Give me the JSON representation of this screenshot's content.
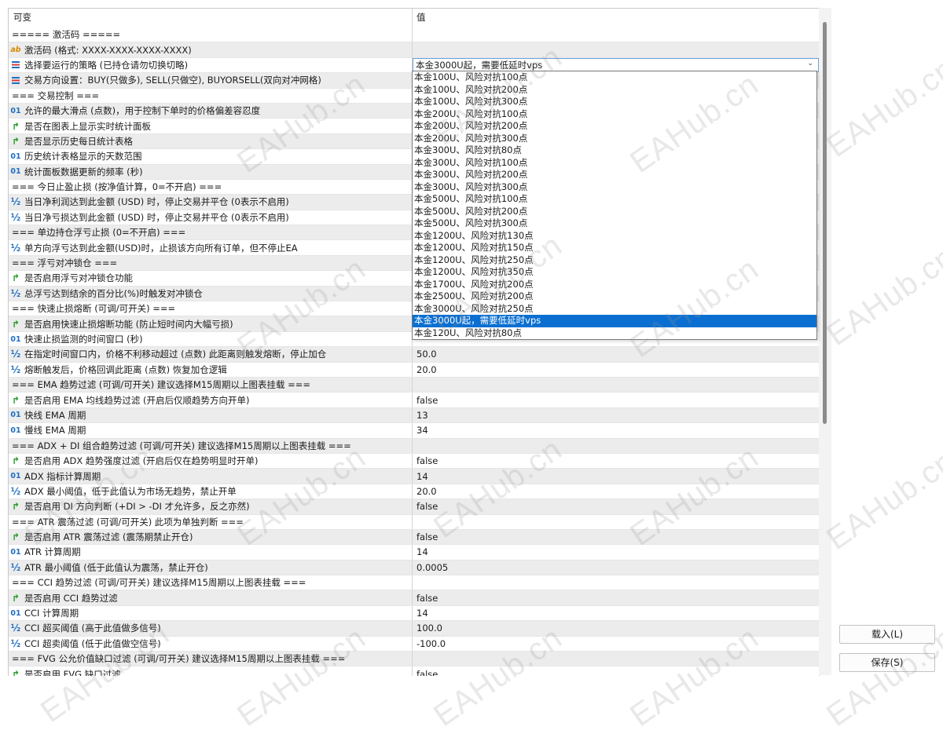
{
  "header": {
    "col_name": "可变",
    "col_value": "值"
  },
  "rows": [
    {
      "t": "none",
      "label": "===== 激活码 =====",
      "value": ""
    },
    {
      "t": "str",
      "label": "激活码 (格式: XXXX-XXXX-XXXX-XXXX)",
      "value": ""
    },
    {
      "t": "enum",
      "label": "选择要运行的策略 (已持仓请勿切换切略)",
      "value": "本金3000U起，需要低延时vps",
      "selected": true
    },
    {
      "t": "enum",
      "label": "交易方向设置：BUY(只做多), SELL(只做空), BUYORSELL(双向对冲网格)",
      "value": ""
    },
    {
      "t": "none",
      "label": "=== 交易控制 ===",
      "value": ""
    },
    {
      "t": "int",
      "label": "允许的最大滑点 (点数)，用于控制下单时的价格偏差容忍度",
      "value": ""
    },
    {
      "t": "bool",
      "label": "是否在图表上显示实时统计面板",
      "value": ""
    },
    {
      "t": "bool",
      "label": "是否显示历史每日统计表格",
      "value": ""
    },
    {
      "t": "int",
      "label": "历史统计表格显示的天数范围",
      "value": ""
    },
    {
      "t": "int",
      "label": "统计面板数据更新的频率 (秒)",
      "value": ""
    },
    {
      "t": "none",
      "label": "=== 今日止盈止损 (按净值计算，0=不开启) ===",
      "value": ""
    },
    {
      "t": "dbl",
      "label": "当日净利润达到此金额 (USD) 时，停止交易并平仓 (0表示不启用)",
      "value": ""
    },
    {
      "t": "dbl",
      "label": "当日净亏损达到此金额 (USD) 时，停止交易并平仓 (0表示不启用)",
      "value": ""
    },
    {
      "t": "none",
      "label": "=== 单边持仓浮亏止损 (0=不开启) ===",
      "value": ""
    },
    {
      "t": "dbl",
      "label": "单方向浮亏达到此金额(USD)时，止损该方向所有订单，但不停止EA",
      "value": ""
    },
    {
      "t": "none",
      "label": "=== 浮亏对冲锁仓 ===",
      "value": ""
    },
    {
      "t": "bool",
      "label": "是否启用浮亏对冲锁仓功能",
      "value": ""
    },
    {
      "t": "dbl",
      "label": "总浮亏达到结余的百分比(%)时触发对冲锁仓",
      "value": ""
    },
    {
      "t": "none",
      "label": "=== 快速止损熔断 (可调/可开关) ===",
      "value": ""
    },
    {
      "t": "bool",
      "label": "是否启用快速止损熔断功能 (防止短时间内大幅亏损)",
      "value": ""
    },
    {
      "t": "int",
      "label": "快速止损监测的时间窗口 (秒)",
      "value": ""
    },
    {
      "t": "dbl",
      "label": "在指定时间窗口内，价格不利移动超过 (点数) 此距离则触发熔断，停止加仓",
      "value": "50.0"
    },
    {
      "t": "dbl",
      "label": "熔断触发后，价格回调此距离 (点数) 恢复加仓逻辑",
      "value": "20.0"
    },
    {
      "t": "none",
      "label": "===  EMA 趋势过滤 (可调/可开关) 建议选择M15周期以上图表挂载 ===",
      "value": ""
    },
    {
      "t": "bool",
      "label": "是否启用 EMA 均线趋势过滤 (开启后仅顺趋势方向开单)",
      "value": "false"
    },
    {
      "t": "int",
      "label": "快线 EMA 周期",
      "value": "13"
    },
    {
      "t": "int",
      "label": "慢线 EMA 周期",
      "value": "34"
    },
    {
      "t": "none",
      "label": "=== ADX + DI 组合趋势过滤 (可调/可开关) 建议选择M15周期以上图表挂载 ===",
      "value": ""
    },
    {
      "t": "bool",
      "label": "是否启用 ADX 趋势强度过滤 (开启后仅在趋势明显时开单)",
      "value": "false"
    },
    {
      "t": "int",
      "label": "ADX 指标计算周期",
      "value": "14"
    },
    {
      "t": "dbl",
      "label": "ADX 最小阈值，低于此值认为市场无趋势，禁止开单",
      "value": "20.0"
    },
    {
      "t": "bool",
      "label": "是否启用 DI 方向判断 (+DI > -DI 才允许多，反之亦然)",
      "value": "false"
    },
    {
      "t": "none",
      "label": "=== ATR 震荡过滤 (可调/可开关) 此项为单独判断 ===",
      "value": ""
    },
    {
      "t": "bool",
      "label": "是否启用 ATR 震荡过滤 (震荡期禁止开仓)",
      "value": "false"
    },
    {
      "t": "int",
      "label": "ATR 计算周期",
      "value": "14"
    },
    {
      "t": "dbl",
      "label": "ATR 最小阈值 (低于此值认为震荡，禁止开仓)",
      "value": "0.0005"
    },
    {
      "t": "none",
      "label": "=== CCI 趋势过滤 (可调/可开关) 建议选择M15周期以上图表挂载 ===",
      "value": ""
    },
    {
      "t": "bool",
      "label": "是否启用 CCI 趋势过滤",
      "value": "false"
    },
    {
      "t": "int",
      "label": "CCI 计算周期",
      "value": "14"
    },
    {
      "t": "dbl",
      "label": "CCI 超买阈值 (高于此值做多信号)",
      "value": "100.0"
    },
    {
      "t": "dbl",
      "label": "CCI 超卖阈值 (低于此值做空信号)",
      "value": "-100.0"
    },
    {
      "t": "none",
      "label": "=== FVG 公允价值缺口过滤 (可调/可开关) 建议选择M15周期以上图表挂载 ===",
      "value": ""
    },
    {
      "t": "bool",
      "label": "是否启用 FVG 缺口过滤",
      "value": "false"
    }
  ],
  "dropdown": {
    "options": [
      "本金100U、风险对抗100点",
      "本金100U、风险对抗200点",
      "本金100U、风险对抗300点",
      "本金200U、风险对抗100点",
      "本金200U、风险对抗200点",
      "本金200U、风险对抗300点",
      "本金300U、风险对抗80点",
      "本金300U、风险对抗100点",
      "本金300U、风险对抗200点",
      "本金300U、风险对抗300点",
      "本金500U、风险对抗100点",
      "本金500U、风险对抗200点",
      "本金500U、风险对抗300点",
      "本金1200U、风险对抗130点",
      "本金1200U、风险对抗150点",
      "本金1200U、风险对抗250点",
      "本金1200U、风险对抗350点",
      "本金1700U、风险对抗200点",
      "本金2500U、风险对抗200点",
      "本金3000U、风险对抗250点",
      "本金3000U起，需要低延时vps",
      "本金120U、风险对抗80点"
    ],
    "selected_index": 20
  },
  "buttons": {
    "load": "载入(L)",
    "save": "保存(S)"
  },
  "watermark": "EAHub.cn",
  "icons": {
    "int": "01",
    "dbl": "½",
    "bool": "↱",
    "str": "ab"
  },
  "colors": {
    "selection": "#0a6fd1",
    "row_alt": "#ececec"
  }
}
